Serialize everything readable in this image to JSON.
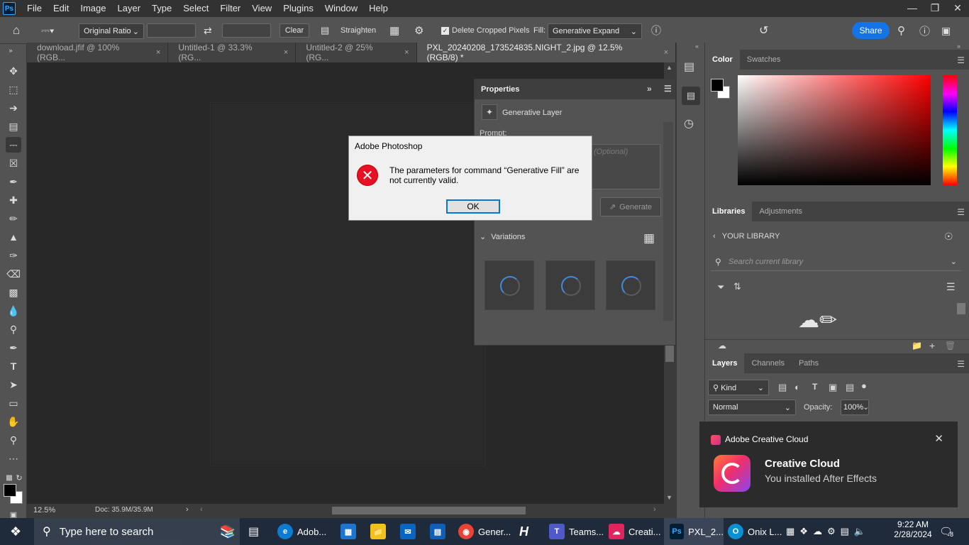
{
  "menubar": {
    "logo": "Ps",
    "items": [
      "File",
      "Edit",
      "Image",
      "Layer",
      "Type",
      "Select",
      "Filter",
      "View",
      "Plugins",
      "Window",
      "Help"
    ]
  },
  "options": {
    "ratio": "Original Ratio",
    "clear": "Clear",
    "straighten": "Straighten",
    "delete_cropped": "Delete Cropped Pixels",
    "fill_label": "Fill:",
    "fill_value": "Generative Expand",
    "share": "Share"
  },
  "tabs": [
    {
      "label": "download.jfif @ 100% (RGB...",
      "close": "×"
    },
    {
      "label": "Untitled-1 @ 33.3% (RG...",
      "close": "×"
    },
    {
      "label": "Untitled-2 @ 25% (RG...",
      "close": "×"
    },
    {
      "label": "PXL_20240208_173524835.NIGHT_2.jpg @ 12.5% (RGB/8) *",
      "close": "×"
    }
  ],
  "properties": {
    "title": "Properties",
    "layer_type": "Generative Layer",
    "prompt_label": "Prompt:",
    "prompt_placeholder": "(Optional)",
    "generate": "Generate",
    "variations": "Variations"
  },
  "status": {
    "zoom": "12.5%",
    "doc": "Doc: 35.9M/35.9M"
  },
  "color_panel": {
    "tabs": [
      "Color",
      "Swatches"
    ],
    "foreground": "#000000",
    "background": "#ffffff",
    "hue": "#ff0000"
  },
  "libraries": {
    "tabs": [
      "Libraries",
      "Adjustments"
    ],
    "your_library": "YOUR LIBRARY",
    "search_placeholder": "Search current library"
  },
  "layers": {
    "tabs": [
      "Layers",
      "Channels",
      "Paths"
    ],
    "kind": "Kind",
    "blend": "Normal",
    "opacity_label": "Opacity:",
    "opacity_value": "100%"
  },
  "dialog": {
    "title": "Adobe Photoshop",
    "message": "The parameters for command “Generative Fill” are not currently valid.",
    "ok": "OK"
  },
  "toast": {
    "app": "Adobe Creative Cloud",
    "heading": "Creative Cloud",
    "body": "You installed After Effects"
  },
  "taskbar": {
    "search_placeholder": "Type here to search",
    "apps": [
      {
        "label": "Adob...",
        "icon": "edge-icon"
      },
      {
        "label": "Gener...",
        "icon": "chrome-icon"
      },
      {
        "label": "Teams...",
        "icon": "teams-icon"
      },
      {
        "label": "Creati...",
        "icon": "creative-cloud-icon"
      },
      {
        "label": "PXL_2...",
        "icon": "photoshop-icon"
      },
      {
        "label": "Onix L...",
        "icon": "onix-icon"
      }
    ],
    "time": "9:22 AM",
    "date": "2/28/2024",
    "notifications": "8"
  }
}
